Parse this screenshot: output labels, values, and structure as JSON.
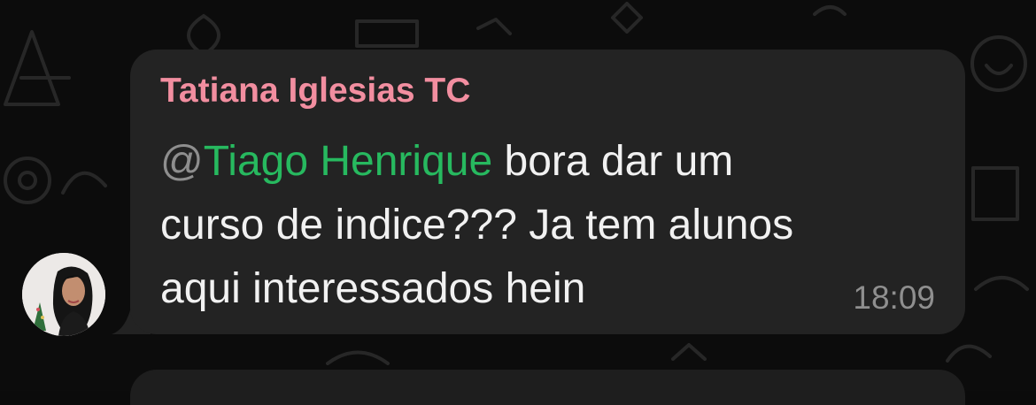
{
  "message": {
    "sender": "Tatiana Iglesias TC",
    "mention_at": "@",
    "mention_name": "Tiago Henrique",
    "text_after_mention": " bora dar um\ncurso de indice??? Ja tem alunos\naqui interessados hein",
    "time": "18:09"
  },
  "colors": {
    "sender": "#f28ea0",
    "mention": "#27b95f",
    "bubble": "#232323",
    "background": "#0c0c0c",
    "timestamp": "#8f8f8f"
  },
  "icons": {
    "avatar": "person-avatar"
  }
}
